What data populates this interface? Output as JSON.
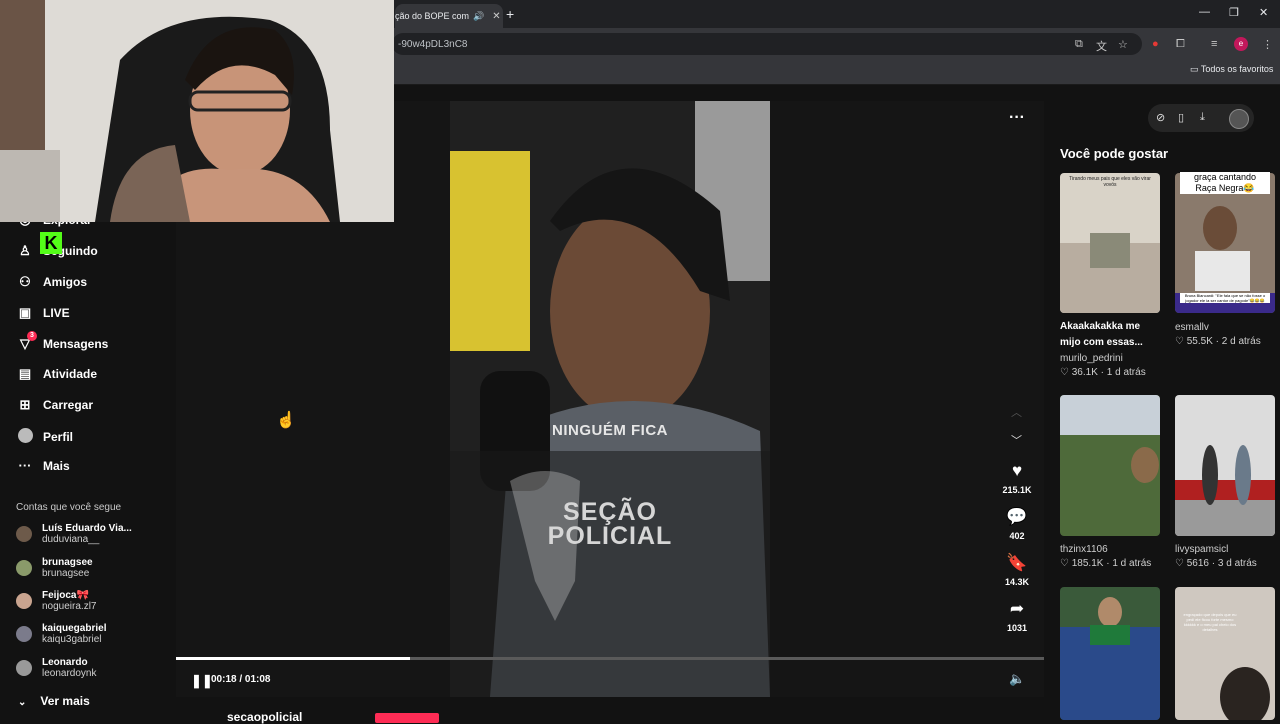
{
  "browser": {
    "tab_title": "ção do BOPE com",
    "url": "-90w4pDL3nC8",
    "bookmarks_label": "Todos os favoritos",
    "profile_initial": "e"
  },
  "sidebar": {
    "nav": [
      {
        "label": "Explorar",
        "icon": "compass-icon"
      },
      {
        "label": "Seguindo",
        "icon": "following-icon"
      },
      {
        "label": "Amigos",
        "icon": "friends-icon"
      },
      {
        "label": "LIVE",
        "icon": "live-icon"
      },
      {
        "label": "Mensagens",
        "icon": "messages-icon",
        "badge": "3"
      },
      {
        "label": "Atividade",
        "icon": "activity-icon"
      },
      {
        "label": "Carregar",
        "icon": "upload-icon"
      },
      {
        "label": "Perfil",
        "icon": "profile-icon"
      },
      {
        "label": "Mais",
        "icon": "more-icon"
      }
    ],
    "following_title": "Contas que você segue",
    "accounts": [
      {
        "name": "Luís Eduardo Via...",
        "handle": "duduviana__"
      },
      {
        "name": "brunagsee",
        "handle": "brunagsee"
      },
      {
        "name": "Feijoca🎀",
        "handle": "nogueira.zl7"
      },
      {
        "name": "kaiquegabriel",
        "handle": "kaiqu3gabriel"
      },
      {
        "name": "Leonardo",
        "handle": "leonardoynk"
      }
    ],
    "see_more": "Ver mais"
  },
  "video": {
    "overlay_text_1": "NINGUÉM FICA",
    "overlay_text_2": "SEÇÃO",
    "overlay_text_3": "POLICIAL",
    "time": "00:18 / 01:08",
    "progress": 0.27,
    "likes": "215.1K",
    "comments": "402",
    "saves": "14.3K",
    "shares": "1031",
    "author": "secaopolicial"
  },
  "suggestions": {
    "title": "Você pode gostar",
    "items": [
      {
        "thumb_text": "Tirando meus pais que eles vão virar vovós",
        "caption1": "Akaakakakka me",
        "caption2": "mijo com essas...",
        "user": "murilo_pedrini",
        "likes": "36.1K",
        "age": "1 d atrás"
      },
      {
        "thumb_text1": "graça cantando",
        "thumb_text2": "Raça Negra😂",
        "thumb_sub": "Bruna Biancardi: \"Ele fala que se não fosse o jogador ele ia ser cantor de pagode\"😂😂😂",
        "user": "esmallv",
        "likes": "55.5K",
        "age": "2 d atrás"
      },
      {
        "user": "thzinx1106",
        "likes": "185.1K",
        "age": "1 d atrás"
      },
      {
        "user": "livyspamsicl",
        "likes": "5616",
        "age": "3 d atrás"
      },
      {},
      {
        "thumb_text": "engraçado que depois que eu pedi ele ficou forte mesmo kkkkkk e o meu pai cheio dos detalhes"
      }
    ]
  }
}
